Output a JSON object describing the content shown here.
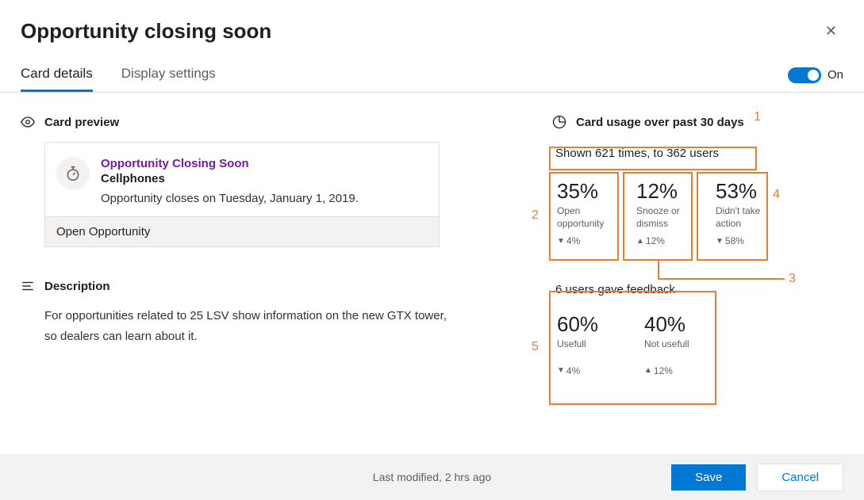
{
  "header": {
    "title": "Opportunity closing soon"
  },
  "tabs": {
    "card_details": "Card details",
    "display_settings": "Display settings",
    "toggle_label": "On"
  },
  "left": {
    "card_preview_heading": "Card preview",
    "preview": {
      "title": "Opportunity Closing Soon",
      "subtitle": "Cellphones",
      "body": "Opportunity closes on Tuesday, January 1, 2019.",
      "action": "Open Opportunity"
    },
    "description_heading": "Description",
    "description_body": "For opportunities related to 25 LSV show information on the new GTX tower, so dealers can learn about it."
  },
  "usage": {
    "heading": "Card usage over past 30 days",
    "summary": "Shown 621 times, to 362 users",
    "stats": [
      {
        "pct": "35%",
        "label": "Open opportunity",
        "arrow": "▼",
        "delta": "4%"
      },
      {
        "pct": "12%",
        "label": "Snooze or dismiss",
        "arrow": "▲",
        "delta": "12%"
      },
      {
        "pct": "53%",
        "label": "Didn't take action",
        "arrow": "▼",
        "delta": "58%"
      }
    ],
    "feedback_title": "6 users gave feedback",
    "feedback_stats": [
      {
        "pct": "60%",
        "label": "Usefull",
        "arrow": "▼",
        "delta": "4%"
      },
      {
        "pct": "40%",
        "label": "Not usefull",
        "arrow": "▲",
        "delta": "12%"
      }
    ]
  },
  "callouts": {
    "c1": "1",
    "c2": "2",
    "c3": "3",
    "c4": "4",
    "c5": "5"
  },
  "footer": {
    "modified": "Last modified, 2 hrs ago",
    "save": "Save",
    "cancel": "Cancel"
  }
}
